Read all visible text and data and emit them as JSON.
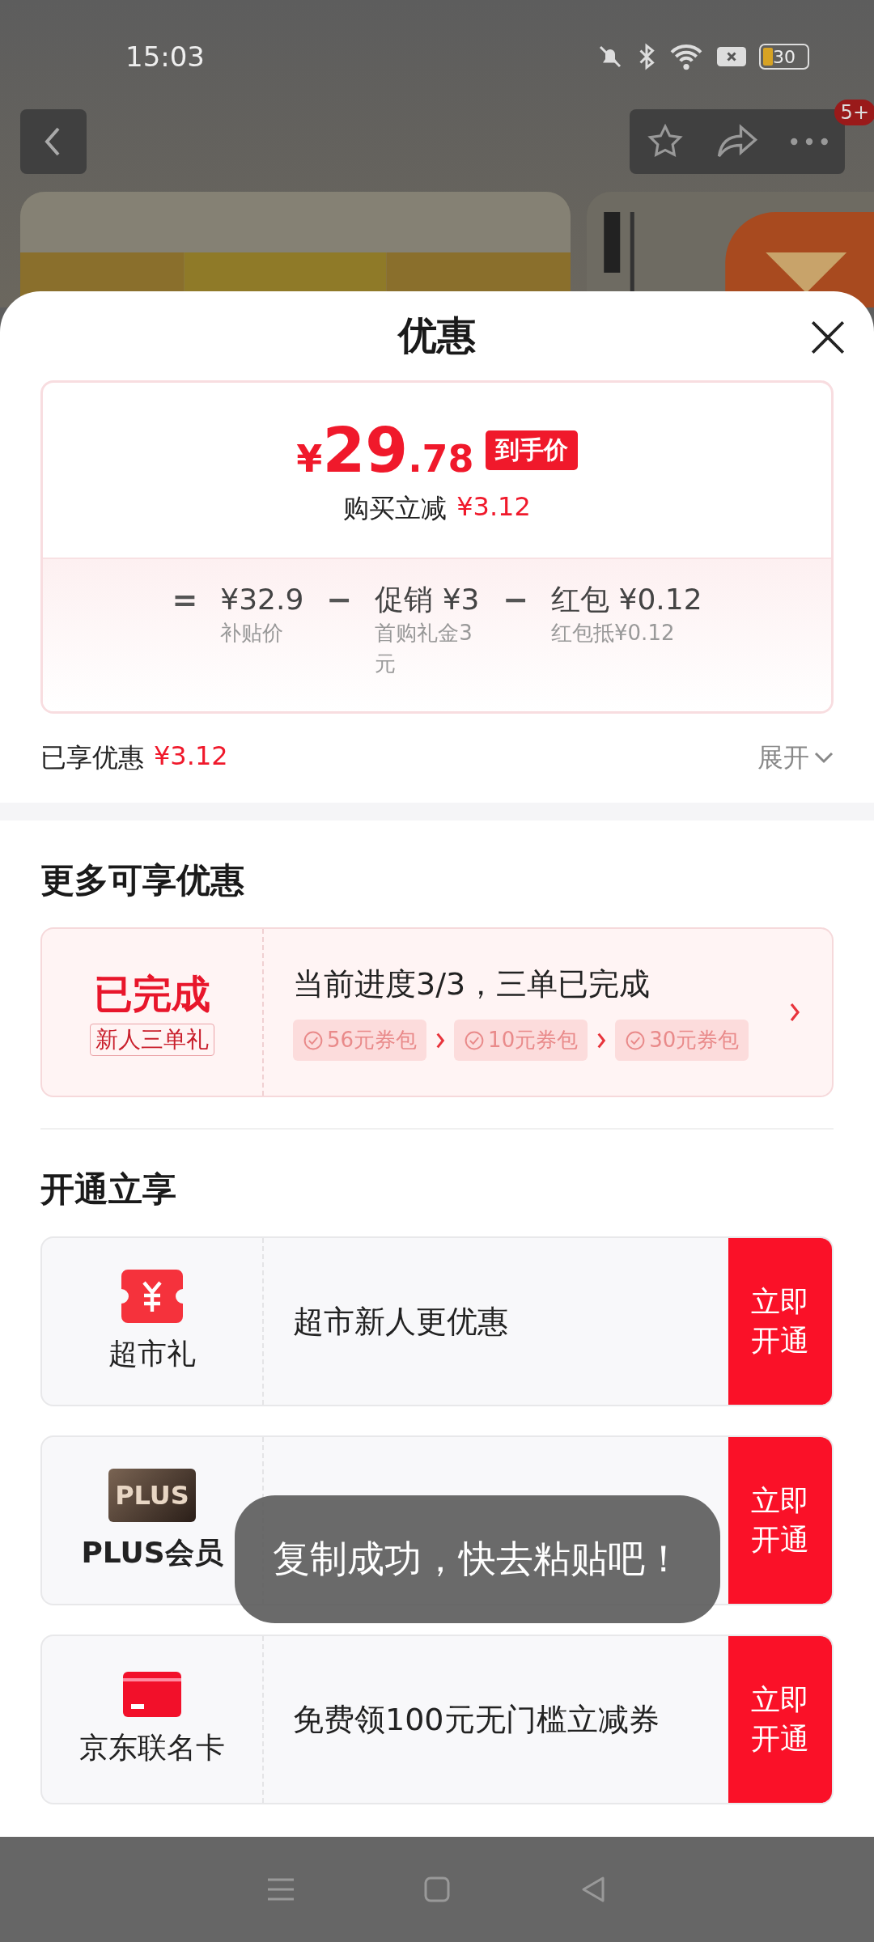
{
  "status_bar": {
    "time": "15:03",
    "battery": "30"
  },
  "top_nav": {
    "badge": "5+"
  },
  "sheet": {
    "title": "优惠"
  },
  "price_card": {
    "currency": "¥",
    "price_int": "29",
    "price_dec": ".78",
    "price_tag": "到手价",
    "saving_label": "购买立减",
    "saving_amount": "¥3.12",
    "formula": [
      {
        "operator": "=",
        "title": "¥32.9",
        "subtitle": "补贴价"
      },
      {
        "operator": "−",
        "title": "促销 ¥3",
        "subtitle": "首购礼金3元"
      },
      {
        "operator": "−",
        "title": "红包 ¥0.12",
        "subtitle": "红包抵¥0.12"
      }
    ]
  },
  "enjoyed": {
    "label": "已享优惠",
    "amount": "¥3.12",
    "expand": "展开"
  },
  "more_offers": {
    "heading": "更多可享优惠",
    "task": {
      "status": "已完成",
      "tag": "新人三单礼",
      "progress": "当前进度3/3，三单已完成",
      "steps": [
        "56元券包",
        "10元券包",
        "30元券包"
      ]
    }
  },
  "open_section": {
    "heading": "开通立享",
    "items": [
      {
        "kind": "coupon",
        "name": "超市礼",
        "desc": "超市新人更优惠",
        "button": "立即开通"
      },
      {
        "kind": "plus",
        "icon_text": "PLUS",
        "name": "PLUS会员",
        "button": "立即开通"
      },
      {
        "kind": "card",
        "name": "京东联名卡",
        "desc": "免费领100元无门槛立减券",
        "button": "立即开通"
      }
    ]
  },
  "toast": "复制成功，快去粘贴吧！"
}
